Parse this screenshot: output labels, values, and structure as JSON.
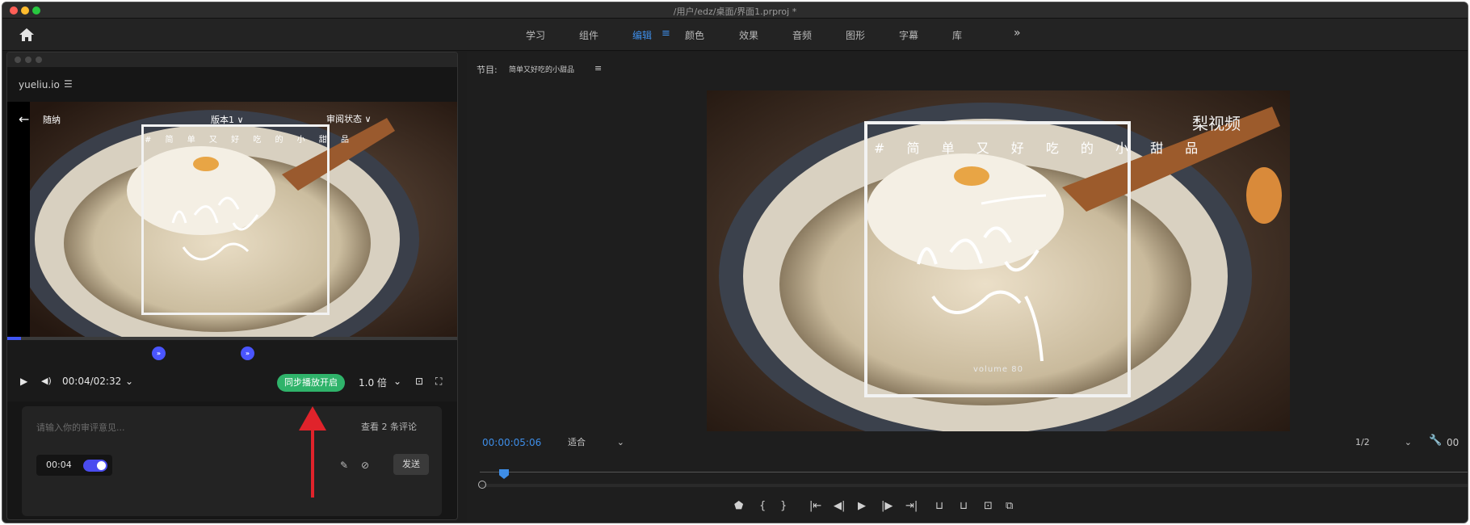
{
  "window": {
    "title": "/用户/edz/桌面/界面1.prproj *",
    "colors": {
      "close": "#ff5f57",
      "minimize": "#febc2e",
      "maximize": "#28c840",
      "accent": "#3e8ee8"
    }
  },
  "workspaces": {
    "tabs": [
      "学习",
      "组件",
      "编辑",
      "颜色",
      "效果",
      "音频",
      "图形",
      "字幕",
      "库"
    ],
    "active_index": 2,
    "active_menu_icon": "≡",
    "more_icon": "»"
  },
  "review_panel": {
    "site": "yueliu.io",
    "site_menu_icon": "☰",
    "video": {
      "back_icon": "←",
      "left_text": "随纳",
      "middle_text": "版本1 ∨",
      "right_text": "审阅状态 ∨",
      "caption": "#  简 单 又 好 吃 的 小 甜 品"
    },
    "progress_fraction": 0.03,
    "markers": [
      "»",
      "»"
    ],
    "controls": {
      "timecode": "00:04/02:32",
      "sync_button": "同步播放开启",
      "speed": "1.0 倍"
    },
    "comment": {
      "placeholder": "请输入你的审评意见...",
      "view_comments": "查看 2 条评论",
      "time": "00:04",
      "send": "发送"
    },
    "arrow_color": "#e0232b"
  },
  "program_monitor": {
    "title": "节目:",
    "sequence_name": "简单又好吃的小甜品",
    "menu_icon": "≡",
    "video": {
      "caption": "#   简 单 又 好 吃 的 小 甜 品",
      "logo": "梨视频",
      "volume": "volume 80"
    },
    "timecode": "00:00:05:06",
    "fit": "适合",
    "resolution": "1/2",
    "timecode_right": "00"
  }
}
